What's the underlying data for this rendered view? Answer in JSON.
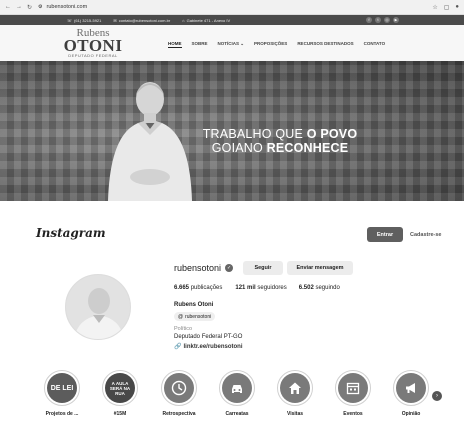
{
  "browser": {
    "url": "rubensotoni.com"
  },
  "infobar": {
    "phone": "(61) 3215-5921",
    "email": "contato@rubensotoni.com.br",
    "address": "Gabinete 471 - Anexo IV"
  },
  "site": {
    "logo_line1": "Rubens",
    "logo_line2": "OTONI",
    "logo_line3": "DEPUTADO FEDERAL",
    "menu": [
      "HOME",
      "SOBRE",
      "NOTÍCIAS ⌄",
      "PROPOSIÇÕES",
      "RECURSOS DESTINADOS",
      "CONTATO"
    ]
  },
  "banner": {
    "line1_a": "TRABALHO QUE ",
    "line1_b": "O POVO",
    "line2_a": "GOIANO ",
    "line2_b": "RECONHECE"
  },
  "instagram": {
    "logo": "Instagram",
    "login_label": "Entrar",
    "signup_label": "Cadastre-se",
    "username": "rubensotoni",
    "follow_label": "Seguir",
    "message_label": "Enviar mensagem",
    "posts_count": "6.665",
    "posts_label": "publicações",
    "followers_count": "121 mil",
    "followers_label": "seguidores",
    "following_count": "6.502",
    "following_label": "seguindo",
    "full_name": "Rubens Otoni",
    "threads_handle": "rubensotoni",
    "category": "Político",
    "bio": "Deputado Federal PT-GO",
    "link": "linktr.ee/rubensotoni",
    "highlights": [
      {
        "label": "Projetos de ...",
        "cover": "DE LEI"
      },
      {
        "label": "#15M",
        "cover": "A AULA SERÁ NA RUA"
      },
      {
        "label": "Retrospectiva",
        "cover": ""
      },
      {
        "label": "Carreatas",
        "cover": ""
      },
      {
        "label": "Visitas",
        "cover": ""
      },
      {
        "label": "Eventos",
        "cover": ""
      },
      {
        "label": "Opinião",
        "cover": ""
      }
    ]
  }
}
